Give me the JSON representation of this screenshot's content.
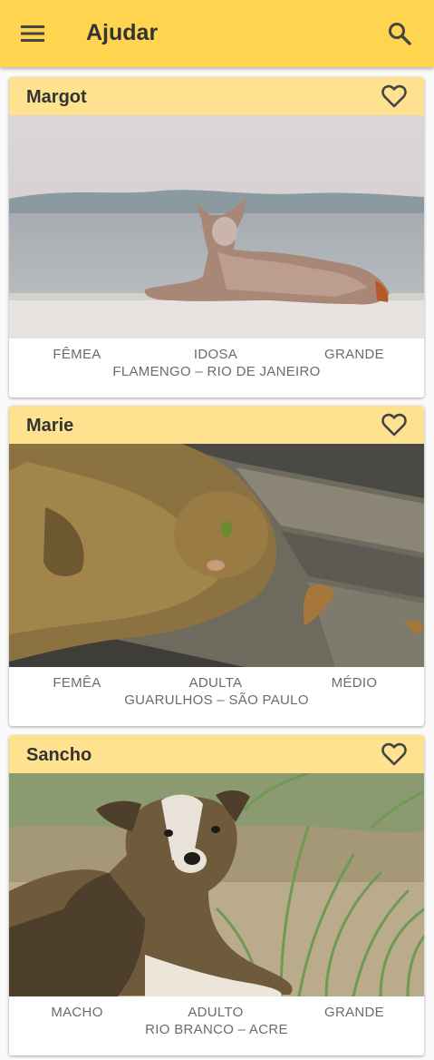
{
  "appbar": {
    "title": "Ajudar",
    "menu_icon": "menu-icon",
    "search_icon": "search-icon",
    "color": "#ffd54f"
  },
  "cards": [
    {
      "name": "Margot",
      "sex": "FÊMEA",
      "age": "IDOSA",
      "size": "GRANDE",
      "location": "FLAMENGO – RIO DE JANEIRO",
      "photo": "dog lying on a wall by the water",
      "favorite_icon": "heart-outline-icon"
    },
    {
      "name": "Marie",
      "sex": "FEMÊA",
      "age": "ADULTA",
      "size": "MÉDIO",
      "location": "GUARULHOS – SÃO PAULO",
      "photo": "tabby cat lying on wooden deck",
      "favorite_icon": "heart-outline-icon"
    },
    {
      "name": "Sancho",
      "sex": "MACHO",
      "age": "ADULTO",
      "size": "GRANDE",
      "location": "RIO BRANCO – ACRE",
      "photo": "dog lying in the grass",
      "favorite_icon": "heart-outline-icon"
    }
  ],
  "colors": {
    "card_header": "#ffe28f",
    "text_primary": "#333333",
    "text_secondary": "#6b6b6b"
  }
}
